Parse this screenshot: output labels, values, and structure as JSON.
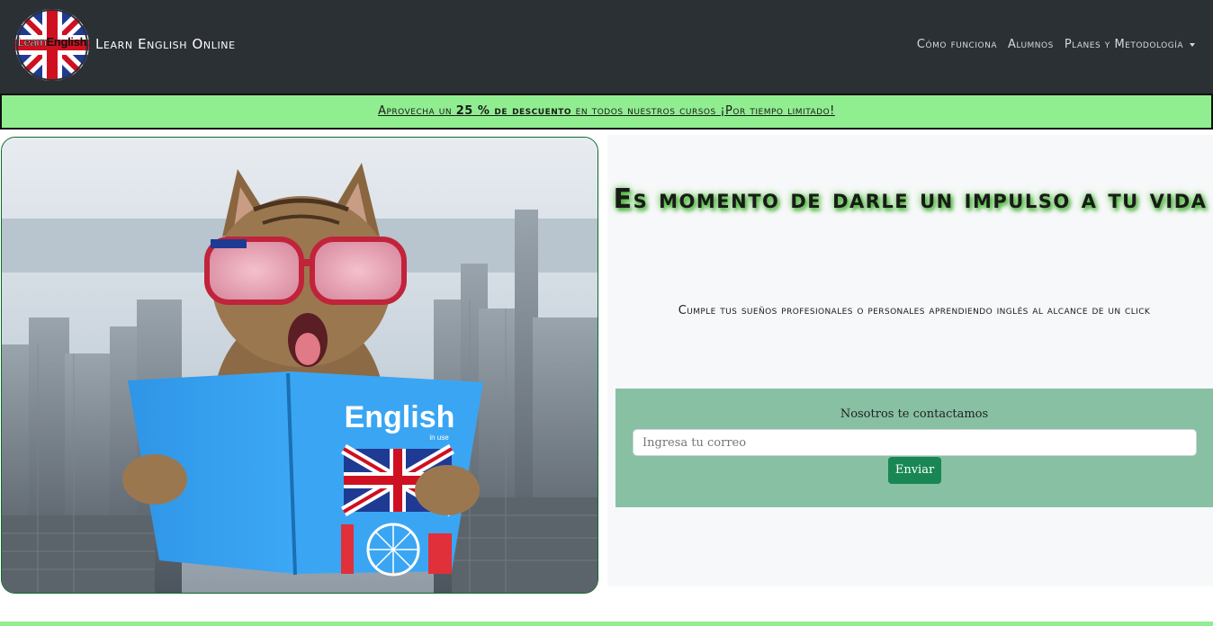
{
  "navbar": {
    "logo_text_learn": "Learn",
    "logo_text_english": "English",
    "brand": "Learn English Online",
    "links": [
      {
        "label": "Cómo funciona"
      },
      {
        "label": "Alumnos"
      },
      {
        "label": "Planes y Metodología"
      }
    ]
  },
  "promo": {
    "text_before": "Aprovecha un ",
    "bold": "25 % de descuento",
    "text_after": " en todos nuestros cursos ¡Por tiempo limitado!"
  },
  "hero": {
    "book_title": "English",
    "book_subtitle": "in use"
  },
  "main": {
    "headline": "Es momento de darle un impulso a tu vida",
    "subline": "Cumple tus sueños profesionales o personales aprendiendo inglés al alcance de un click"
  },
  "contact": {
    "label": "Nosotros te contactamos",
    "email_placeholder": "Ingresa tu correo",
    "submit_label": "Enviar"
  },
  "colors": {
    "navbar_bg": "#2b3035",
    "promo_bg": "#90ee90",
    "contact_bg": "#88c0a3",
    "button_bg": "#198754",
    "headline_glow": "#4fc13a"
  },
  "icons": [
    "uk-flag-logo-icon",
    "dropdown-caret-icon"
  ]
}
